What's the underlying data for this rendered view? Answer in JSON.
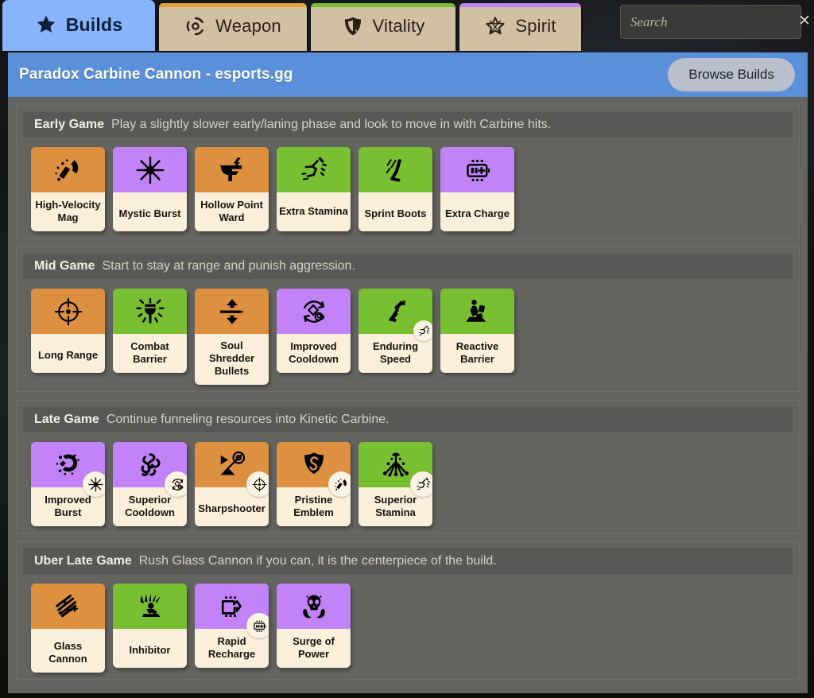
{
  "tabs": [
    {
      "label": "Builds",
      "icon": "star-filled-icon",
      "accent": "#87b4fb",
      "active": true
    },
    {
      "label": "Weapon",
      "icon": "weapon-icon",
      "accent": "#e8a33c",
      "active": false
    },
    {
      "label": "Vitality",
      "icon": "shield-icon",
      "accent": "#78bf31",
      "active": false
    },
    {
      "label": "Spirit",
      "icon": "star-outline-icon",
      "accent": "#c183f7",
      "active": false
    }
  ],
  "search": {
    "placeholder": "Search",
    "value": "",
    "clear_label": "✕"
  },
  "header": {
    "title": "Paradox Carbine Cannon - esports.gg",
    "browse_label": "Browse Builds"
  },
  "colors": {
    "weapon": "#dd9140",
    "vitality": "#78bf31",
    "spirit": "#c183f7",
    "header_bar": "#5a90d9",
    "body_bg": "#636360",
    "card_bg": "#faefd9",
    "tab_inactive": "#d2c0a5",
    "tab_active": "#87b4fb"
  },
  "sections": [
    {
      "name": "Early Game",
      "desc": "Play a slightly slower early/laning phase and look to move in with Carbine hits.",
      "items": [
        {
          "name": "High-Velocity Mag",
          "category": "weapon",
          "glyph": "magnet-icon",
          "badge": null
        },
        {
          "name": "Mystic Burst",
          "category": "spirit",
          "glyph": "starburst-icon",
          "badge": null
        },
        {
          "name": "Hollow Point Ward",
          "category": "weapon",
          "glyph": "pistol-bolt-icon",
          "badge": null
        },
        {
          "name": "Extra Stamina",
          "category": "vitality",
          "glyph": "running-legs-icon",
          "badge": null
        },
        {
          "name": "Sprint Boots",
          "category": "vitality",
          "glyph": "boot-speed-icon",
          "badge": null
        },
        {
          "name": "Extra Charge",
          "category": "spirit",
          "glyph": "battery-plus-icon",
          "badge": null
        }
      ]
    },
    {
      "name": "Mid Game",
      "desc": "Start to stay at range and punish aggression.",
      "items": [
        {
          "name": "Long Range",
          "category": "weapon",
          "glyph": "crosshair-icon",
          "badge": null
        },
        {
          "name": "Combat Barrier",
          "category": "vitality",
          "glyph": "shield-burst-icon",
          "badge": null
        },
        {
          "name": "Soul Shredder Bullets",
          "category": "weapon",
          "glyph": "up-down-arrows-icon",
          "badge": null
        },
        {
          "name": "Improved Cooldown",
          "category": "spirit",
          "glyph": "cooldown-cycle-icon",
          "badge": null
        },
        {
          "name": "Enduring Speed",
          "category": "vitality",
          "glyph": "winged-boot-icon",
          "badge": "running-legs-icon"
        },
        {
          "name": "Reactive Barrier",
          "category": "vitality",
          "glyph": "figure-shield-icon",
          "badge": null
        }
      ]
    },
    {
      "name": "Late Game",
      "desc": "Continue funneling resources into Kinetic Carbine.",
      "items": [
        {
          "name": "Improved Burst",
          "category": "spirit",
          "glyph": "burst-splash-icon",
          "badge": "starburst-icon"
        },
        {
          "name": "Superior Cooldown",
          "category": "spirit",
          "glyph": "swirl-knot-icon",
          "badge": "cooldown-cycle-icon"
        },
        {
          "name": "Sharpshooter",
          "category": "weapon",
          "glyph": "arrow-target-icon",
          "badge": "crosshair-icon"
        },
        {
          "name": "Pristine Emblem",
          "category": "weapon",
          "glyph": "emblem-shield-icon",
          "badge": "magnet-icon"
        },
        {
          "name": "Superior Stamina",
          "category": "vitality",
          "glyph": "jump-burst-icon",
          "badge": "running-legs-icon"
        }
      ]
    },
    {
      "name": "Uber Late Game",
      "desc": "Rush Glass Cannon if you can, it is the centerpiece of the build.",
      "items": [
        {
          "name": "Glass Cannon",
          "category": "weapon",
          "glyph": "glass-shards-icon",
          "badge": null
        },
        {
          "name": "Inhibitor",
          "category": "vitality",
          "glyph": "kneeling-figure-icon",
          "badge": null
        },
        {
          "name": "Rapid Recharge",
          "category": "spirit",
          "glyph": "recharge-chip-icon",
          "badge": "battery-plus-icon"
        },
        {
          "name": "Surge of Power",
          "category": "spirit",
          "glyph": "skull-hand-icon",
          "badge": null
        }
      ]
    }
  ]
}
